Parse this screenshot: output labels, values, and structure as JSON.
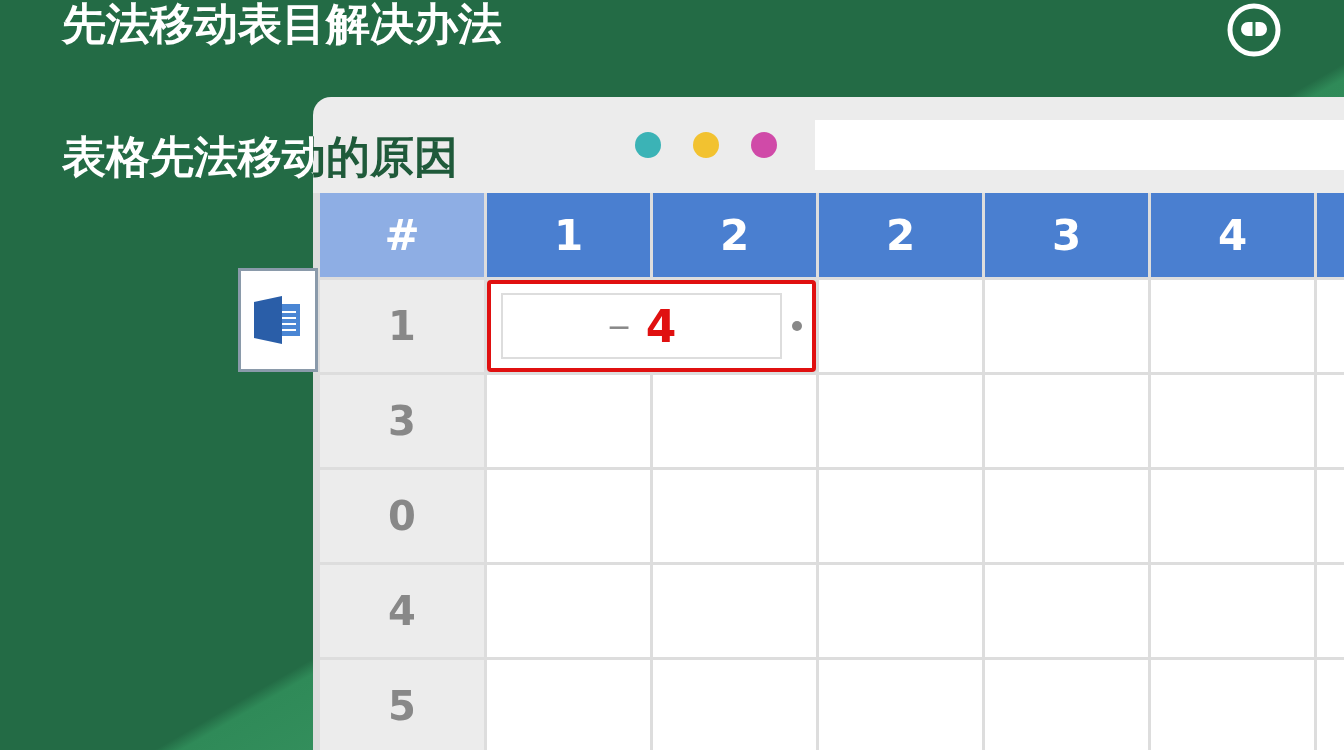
{
  "title": "先法移动表目解决办法",
  "subtitle": "表格先法移动的原因",
  "window": {
    "traffic_lights": [
      {
        "color": "#3bb3b6"
      },
      {
        "color": "#f2c230"
      },
      {
        "color": "#d04aa8"
      }
    ]
  },
  "table": {
    "columns": [
      "#",
      "1",
      "2",
      "2",
      "3",
      "4"
    ],
    "rows": [
      {
        "label": "1",
        "selected": true,
        "entry": {
          "sign": "−",
          "value": "4"
        }
      },
      {
        "label": "3",
        "selected": false
      },
      {
        "label": "0",
        "selected": false
      },
      {
        "label": "4",
        "selected": false
      },
      {
        "label": "5",
        "selected": false
      }
    ]
  }
}
